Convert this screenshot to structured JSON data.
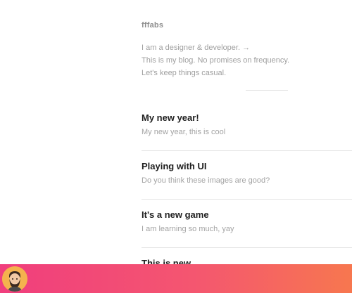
{
  "site": {
    "name": "fffabs",
    "bio_lines": [
      "I am a designer & developer. →",
      "This is my blog. No promises on frequency.",
      "Let's keep things casual."
    ]
  },
  "posts": [
    {
      "title": "My new year!",
      "description": "My new year, this is cool"
    },
    {
      "title": "Playing with UI",
      "description": "Do you think these images are good?"
    },
    {
      "title": "It's a new game",
      "description": "I am learning so much, yay"
    },
    {
      "title": "This is new",
      "description": ""
    }
  ],
  "bottom_bar": {
    "avatar_icon": "bearded-man-avatar-icon",
    "colors": {
      "start": "#f03e7d",
      "end": "#f7774f"
    }
  }
}
